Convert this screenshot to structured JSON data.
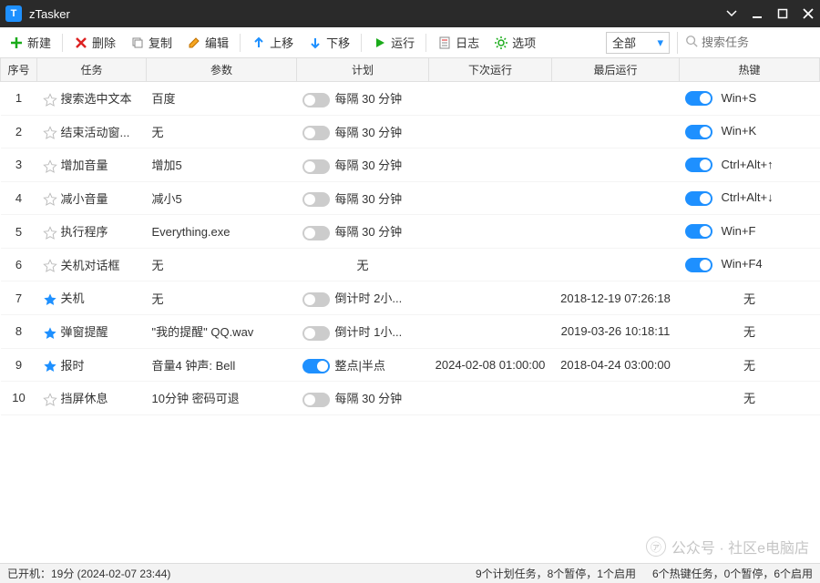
{
  "app": {
    "title": "zTasker"
  },
  "toolbar": {
    "new": "新建",
    "delete": "删除",
    "copy": "复制",
    "edit": "编辑",
    "moveup": "上移",
    "movedown": "下移",
    "run": "运行",
    "log": "日志",
    "options": "选项",
    "filter": "全部",
    "search_placeholder": "搜索任务"
  },
  "columns": {
    "idx": "序号",
    "task": "任务",
    "param": "参数",
    "plan": "计划",
    "next": "下次运行",
    "last": "最后运行",
    "hotkey": "热键"
  },
  "rows": [
    {
      "idx": "1",
      "star": false,
      "task": "搜索选中文本",
      "param": "百度",
      "plan_on": false,
      "plan": "每隔 30 分钟",
      "next": "",
      "last": "",
      "hot_on": true,
      "hotkey": "Win+S"
    },
    {
      "idx": "2",
      "star": false,
      "task": "结束活动窗...",
      "param": "无",
      "plan_on": false,
      "plan": "每隔 30 分钟",
      "next": "",
      "last": "",
      "hot_on": true,
      "hotkey": "Win+K"
    },
    {
      "idx": "3",
      "star": false,
      "task": "增加音量",
      "param": "增加5",
      "plan_on": false,
      "plan": "每隔 30 分钟",
      "next": "",
      "last": "",
      "hot_on": true,
      "hotkey": "Ctrl+Alt+↑"
    },
    {
      "idx": "4",
      "star": false,
      "task": "减小音量",
      "param": "减小5",
      "plan_on": false,
      "plan": "每隔 30 分钟",
      "next": "",
      "last": "",
      "hot_on": true,
      "hotkey": "Ctrl+Alt+↓"
    },
    {
      "idx": "5",
      "star": false,
      "task": "执行程序",
      "param": "Everything.exe",
      "plan_on": false,
      "plan": "每隔 30 分钟",
      "next": "",
      "last": "",
      "hot_on": true,
      "hotkey": "Win+F"
    },
    {
      "idx": "6",
      "star": false,
      "task": "关机对话框",
      "param": "无",
      "plan_on": null,
      "plan": "无",
      "next": "",
      "last": "",
      "hot_on": true,
      "hotkey": "Win+F4"
    },
    {
      "idx": "7",
      "star": true,
      "task": "关机",
      "param": "无",
      "plan_on": false,
      "plan": "倒计时 2小...",
      "next": "",
      "last": "2018-12-19 07:26:18",
      "hot_on": null,
      "hotkey": "无"
    },
    {
      "idx": "8",
      "star": true,
      "task": "弹窗提醒",
      "param": "\"我的提醒\" QQ.wav",
      "plan_on": false,
      "plan": "倒计时 1小...",
      "next": "",
      "last": "2019-03-26 10:18:11",
      "hot_on": null,
      "hotkey": "无"
    },
    {
      "idx": "9",
      "star": true,
      "task": "报时",
      "param": "音量4 钟声: Bell",
      "plan_on": true,
      "plan": "整点|半点",
      "next": "2024-02-08 01:00:00",
      "last": "2018-04-24 03:00:00",
      "hot_on": null,
      "hotkey": "无"
    },
    {
      "idx": "10",
      "star": false,
      "task": "挡屏休息",
      "param": "10分钟 密码可退",
      "plan_on": false,
      "plan": "每隔 30 分钟",
      "next": "",
      "last": "",
      "hot_on": null,
      "hotkey": "无"
    }
  ],
  "status": {
    "left": "已开机：19分 (2024-02-07 23:44)",
    "plan": "9个计划任务，8个暂停，1个启用",
    "hot": "6个热键任务，0个暂停，6个启用"
  },
  "watermark": "公众号 · 社区e电脑店"
}
